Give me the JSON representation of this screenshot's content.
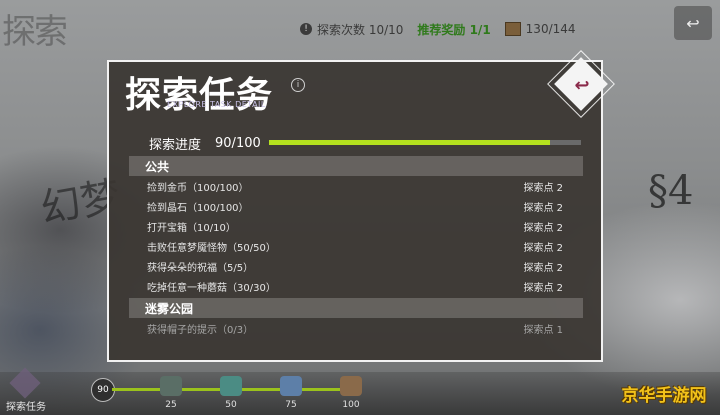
{
  "background": {
    "calligraphy": "探索",
    "left_deco": "幻梦",
    "right_deco": "§4"
  },
  "top_hud": {
    "explore_count_label": "探索次数 10/10",
    "reward_label": "推荐奖励 1/1",
    "box_count": "130/144",
    "back_glyph": "↩"
  },
  "modal": {
    "title": "探索任务",
    "subtitle": "EXPLORE TASK DETAIL",
    "info_glyph": "i",
    "close_glyph": "↩",
    "progress": {
      "label": "探索进度",
      "value_text": "90/100",
      "fraction": 0.9
    },
    "sections": [
      {
        "header": "公共",
        "tasks": [
          {
            "name": "捡到金币（100/100）",
            "reward": "探索点 2"
          },
          {
            "name": "捡到晶石（100/100）",
            "reward": "探索点 2"
          },
          {
            "name": "打开宝箱（10/10）",
            "reward": "探索点 2"
          },
          {
            "name": "击败任意梦魇怪物（50/50）",
            "reward": "探索点 2"
          },
          {
            "name": "获得朵朵的祝福（5/5）",
            "reward": "探索点 2"
          },
          {
            "name": "吃掉任意一种蘑菇（30/30）",
            "reward": "探索点 2"
          }
        ]
      },
      {
        "header": "迷雾公园",
        "tasks": [
          {
            "name": "获得帽子的提示（0/3）",
            "reward": "探索点 1"
          }
        ]
      }
    ]
  },
  "bottom_bar": {
    "label": "探索任务",
    "start_value": "90",
    "milestones": [
      "25",
      "50",
      "75",
      "100"
    ],
    "milestone_colors": [
      "#5a6e66",
      "#4b8c84",
      "#5d7fa8",
      "#8a6a4a"
    ]
  },
  "watermark": "京华手游网"
}
